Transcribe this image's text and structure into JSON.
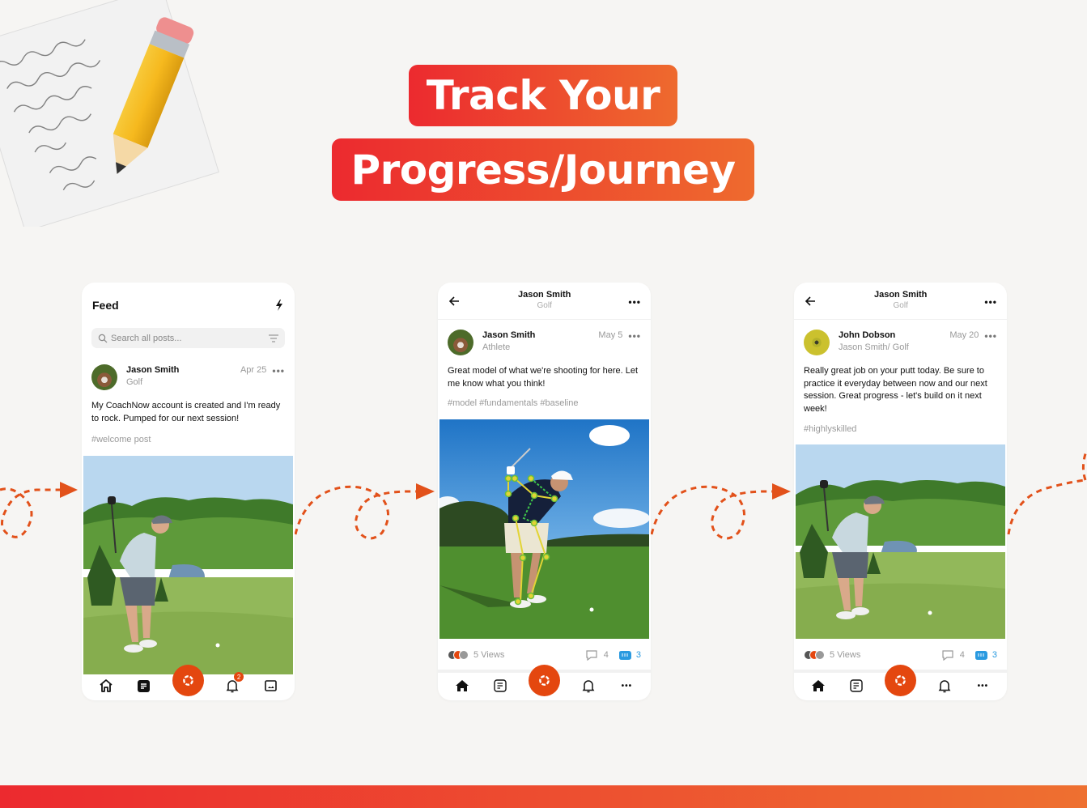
{
  "hero": {
    "line1": "Track Your",
    "line2": "Progress/Journey",
    "gradient_start": "#ec2a2f",
    "gradient_end": "#ee6a2e"
  },
  "accent": "#e4470f",
  "phones": [
    {
      "screen": "feed",
      "header_title": "Feed",
      "header_icon": "lightning-icon",
      "search_placeholder": "Search all posts...",
      "post": {
        "author": "Jason Smith",
        "role": "Golf",
        "date": "Apr 25",
        "body": "My CoachNow account is created and I'm ready to rock. Pumped for our next session!",
        "tags": "#welcome post",
        "image": "golfer-tee-shot-photo"
      },
      "tabbar": [
        "home-icon",
        "notes-icon",
        "camera-shutter-icon",
        "bell-icon",
        "gallery-icon"
      ],
      "notification_count": "2"
    },
    {
      "screen": "post-detail",
      "nav_title": "Jason Smith",
      "nav_subtitle": "Golf",
      "post": {
        "author": "Jason Smith",
        "role": "Athlete",
        "date": "May 5",
        "body": "Great model of what we're shooting for here. Let me know what you think!",
        "tags": "#model #fundamentals #baseline",
        "image": "golfer-swing-pose-analysis-photo"
      },
      "views": "5 Views",
      "comments": "4",
      "fist_bumps": "3",
      "tabbar": [
        "home-icon",
        "notes-icon",
        "camera-shutter-icon",
        "bell-icon",
        "more-icon"
      ]
    },
    {
      "screen": "post-detail",
      "nav_title": "Jason Smith",
      "nav_subtitle": "Golf",
      "post": {
        "author": "John Dobson",
        "role": "Jason Smith/ Golf",
        "date": "May 20",
        "body": "Really great job on your putt today. Be sure to practice it everyday between now and our next session. Great progress - let's build on it next week!",
        "tags": "#highlyskilled",
        "image": "golfer-tee-shot-photo"
      },
      "views": "5 Views",
      "comments": "4",
      "fist_bumps": "3",
      "tabbar": [
        "home-icon",
        "notes-icon",
        "camera-shutter-icon",
        "bell-icon",
        "more-icon"
      ]
    }
  ]
}
